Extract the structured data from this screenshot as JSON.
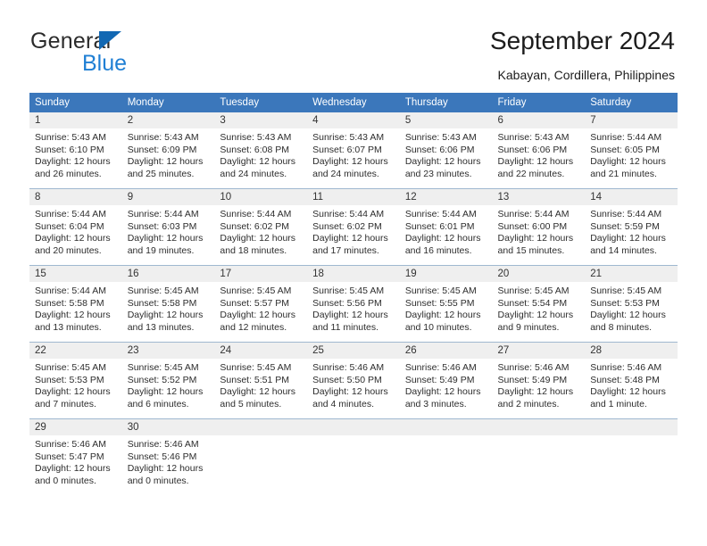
{
  "brand": {
    "name_primary": "General",
    "name_secondary": "Blue",
    "triangle_color": "#1268b3",
    "secondary_color": "#1f7fd4"
  },
  "header": {
    "title": "September 2024",
    "subtitle": "Kabayan, Cordillera, Philippines"
  },
  "theme": {
    "header_row_bg": "#3b77bb",
    "daynum_bg": "#efefef",
    "row_divider": "#9fb8d0"
  },
  "weekday_headers": [
    "Sunday",
    "Monday",
    "Tuesday",
    "Wednesday",
    "Thursday",
    "Friday",
    "Saturday"
  ],
  "weeks": [
    [
      {
        "day": "1",
        "sunrise": "Sunrise: 5:43 AM",
        "sunset": "Sunset: 6:10 PM",
        "daylight_line1": "Daylight: 12 hours",
        "daylight_line2": "and 26 minutes."
      },
      {
        "day": "2",
        "sunrise": "Sunrise: 5:43 AM",
        "sunset": "Sunset: 6:09 PM",
        "daylight_line1": "Daylight: 12 hours",
        "daylight_line2": "and 25 minutes."
      },
      {
        "day": "3",
        "sunrise": "Sunrise: 5:43 AM",
        "sunset": "Sunset: 6:08 PM",
        "daylight_line1": "Daylight: 12 hours",
        "daylight_line2": "and 24 minutes."
      },
      {
        "day": "4",
        "sunrise": "Sunrise: 5:43 AM",
        "sunset": "Sunset: 6:07 PM",
        "daylight_line1": "Daylight: 12 hours",
        "daylight_line2": "and 24 minutes."
      },
      {
        "day": "5",
        "sunrise": "Sunrise: 5:43 AM",
        "sunset": "Sunset: 6:06 PM",
        "daylight_line1": "Daylight: 12 hours",
        "daylight_line2": "and 23 minutes."
      },
      {
        "day": "6",
        "sunrise": "Sunrise: 5:43 AM",
        "sunset": "Sunset: 6:06 PM",
        "daylight_line1": "Daylight: 12 hours",
        "daylight_line2": "and 22 minutes."
      },
      {
        "day": "7",
        "sunrise": "Sunrise: 5:44 AM",
        "sunset": "Sunset: 6:05 PM",
        "daylight_line1": "Daylight: 12 hours",
        "daylight_line2": "and 21 minutes."
      }
    ],
    [
      {
        "day": "8",
        "sunrise": "Sunrise: 5:44 AM",
        "sunset": "Sunset: 6:04 PM",
        "daylight_line1": "Daylight: 12 hours",
        "daylight_line2": "and 20 minutes."
      },
      {
        "day": "9",
        "sunrise": "Sunrise: 5:44 AM",
        "sunset": "Sunset: 6:03 PM",
        "daylight_line1": "Daylight: 12 hours",
        "daylight_line2": "and 19 minutes."
      },
      {
        "day": "10",
        "sunrise": "Sunrise: 5:44 AM",
        "sunset": "Sunset: 6:02 PM",
        "daylight_line1": "Daylight: 12 hours",
        "daylight_line2": "and 18 minutes."
      },
      {
        "day": "11",
        "sunrise": "Sunrise: 5:44 AM",
        "sunset": "Sunset: 6:02 PM",
        "daylight_line1": "Daylight: 12 hours",
        "daylight_line2": "and 17 minutes."
      },
      {
        "day": "12",
        "sunrise": "Sunrise: 5:44 AM",
        "sunset": "Sunset: 6:01 PM",
        "daylight_line1": "Daylight: 12 hours",
        "daylight_line2": "and 16 minutes."
      },
      {
        "day": "13",
        "sunrise": "Sunrise: 5:44 AM",
        "sunset": "Sunset: 6:00 PM",
        "daylight_line1": "Daylight: 12 hours",
        "daylight_line2": "and 15 minutes."
      },
      {
        "day": "14",
        "sunrise": "Sunrise: 5:44 AM",
        "sunset": "Sunset: 5:59 PM",
        "daylight_line1": "Daylight: 12 hours",
        "daylight_line2": "and 14 minutes."
      }
    ],
    [
      {
        "day": "15",
        "sunrise": "Sunrise: 5:44 AM",
        "sunset": "Sunset: 5:58 PM",
        "daylight_line1": "Daylight: 12 hours",
        "daylight_line2": "and 13 minutes."
      },
      {
        "day": "16",
        "sunrise": "Sunrise: 5:45 AM",
        "sunset": "Sunset: 5:58 PM",
        "daylight_line1": "Daylight: 12 hours",
        "daylight_line2": "and 13 minutes."
      },
      {
        "day": "17",
        "sunrise": "Sunrise: 5:45 AM",
        "sunset": "Sunset: 5:57 PM",
        "daylight_line1": "Daylight: 12 hours",
        "daylight_line2": "and 12 minutes."
      },
      {
        "day": "18",
        "sunrise": "Sunrise: 5:45 AM",
        "sunset": "Sunset: 5:56 PM",
        "daylight_line1": "Daylight: 12 hours",
        "daylight_line2": "and 11 minutes."
      },
      {
        "day": "19",
        "sunrise": "Sunrise: 5:45 AM",
        "sunset": "Sunset: 5:55 PM",
        "daylight_line1": "Daylight: 12 hours",
        "daylight_line2": "and 10 minutes."
      },
      {
        "day": "20",
        "sunrise": "Sunrise: 5:45 AM",
        "sunset": "Sunset: 5:54 PM",
        "daylight_line1": "Daylight: 12 hours",
        "daylight_line2": "and 9 minutes."
      },
      {
        "day": "21",
        "sunrise": "Sunrise: 5:45 AM",
        "sunset": "Sunset: 5:53 PM",
        "daylight_line1": "Daylight: 12 hours",
        "daylight_line2": "and 8 minutes."
      }
    ],
    [
      {
        "day": "22",
        "sunrise": "Sunrise: 5:45 AM",
        "sunset": "Sunset: 5:53 PM",
        "daylight_line1": "Daylight: 12 hours",
        "daylight_line2": "and 7 minutes."
      },
      {
        "day": "23",
        "sunrise": "Sunrise: 5:45 AM",
        "sunset": "Sunset: 5:52 PM",
        "daylight_line1": "Daylight: 12 hours",
        "daylight_line2": "and 6 minutes."
      },
      {
        "day": "24",
        "sunrise": "Sunrise: 5:45 AM",
        "sunset": "Sunset: 5:51 PM",
        "daylight_line1": "Daylight: 12 hours",
        "daylight_line2": "and 5 minutes."
      },
      {
        "day": "25",
        "sunrise": "Sunrise: 5:46 AM",
        "sunset": "Sunset: 5:50 PM",
        "daylight_line1": "Daylight: 12 hours",
        "daylight_line2": "and 4 minutes."
      },
      {
        "day": "26",
        "sunrise": "Sunrise: 5:46 AM",
        "sunset": "Sunset: 5:49 PM",
        "daylight_line1": "Daylight: 12 hours",
        "daylight_line2": "and 3 minutes."
      },
      {
        "day": "27",
        "sunrise": "Sunrise: 5:46 AM",
        "sunset": "Sunset: 5:49 PM",
        "daylight_line1": "Daylight: 12 hours",
        "daylight_line2": "and 2 minutes."
      },
      {
        "day": "28",
        "sunrise": "Sunrise: 5:46 AM",
        "sunset": "Sunset: 5:48 PM",
        "daylight_line1": "Daylight: 12 hours",
        "daylight_line2": "and 1 minute."
      }
    ],
    [
      {
        "day": "29",
        "sunrise": "Sunrise: 5:46 AM",
        "sunset": "Sunset: 5:47 PM",
        "daylight_line1": "Daylight: 12 hours",
        "daylight_line2": "and 0 minutes."
      },
      {
        "day": "30",
        "sunrise": "Sunrise: 5:46 AM",
        "sunset": "Sunset: 5:46 PM",
        "daylight_line1": "Daylight: 12 hours",
        "daylight_line2": "and 0 minutes."
      },
      {
        "day": "",
        "sunrise": "",
        "sunset": "",
        "daylight_line1": "",
        "daylight_line2": ""
      },
      {
        "day": "",
        "sunrise": "",
        "sunset": "",
        "daylight_line1": "",
        "daylight_line2": ""
      },
      {
        "day": "",
        "sunrise": "",
        "sunset": "",
        "daylight_line1": "",
        "daylight_line2": ""
      },
      {
        "day": "",
        "sunrise": "",
        "sunset": "",
        "daylight_line1": "",
        "daylight_line2": ""
      },
      {
        "day": "",
        "sunrise": "",
        "sunset": "",
        "daylight_line1": "",
        "daylight_line2": ""
      }
    ]
  ]
}
